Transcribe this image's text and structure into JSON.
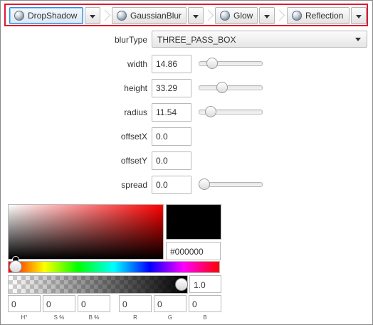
{
  "breadcrumb": {
    "items": [
      {
        "label": "DropShadow",
        "selected": true
      },
      {
        "label": "GaussianBlur",
        "selected": false
      },
      {
        "label": "Glow",
        "selected": false
      },
      {
        "label": "Reflection",
        "selected": false
      }
    ]
  },
  "properties": {
    "blurType": {
      "label": "blurType",
      "value": "THREE_PASS_BOX"
    },
    "width": {
      "label": "width",
      "value": "14.86",
      "slider_fraction": 0.149
    },
    "height": {
      "label": "height",
      "value": "33.29",
      "slider_fraction": 0.333
    },
    "radius": {
      "label": "radius",
      "value": "11.54",
      "slider_fraction": 0.1154
    },
    "offsetX": {
      "label": "offsetX",
      "value": "0.0"
    },
    "offsetY": {
      "label": "offsetY",
      "value": "0.0"
    },
    "spread": {
      "label": "spread",
      "value": "0.0",
      "slider_fraction": 0.0
    }
  },
  "color_picker": {
    "hex": "#000000",
    "preview_color": "#000000",
    "alpha": "1.0",
    "fields": [
      {
        "label": "H°",
        "value": "0"
      },
      {
        "label": "S %",
        "value": "0"
      },
      {
        "label": "B %",
        "value": "0"
      },
      {
        "label": "R",
        "value": "0"
      },
      {
        "label": "G",
        "value": "0"
      },
      {
        "label": "B",
        "value": "0"
      }
    ]
  },
  "colors": {
    "highlight_border": "#e0182f",
    "selected_border": "#2d8fe0"
  }
}
